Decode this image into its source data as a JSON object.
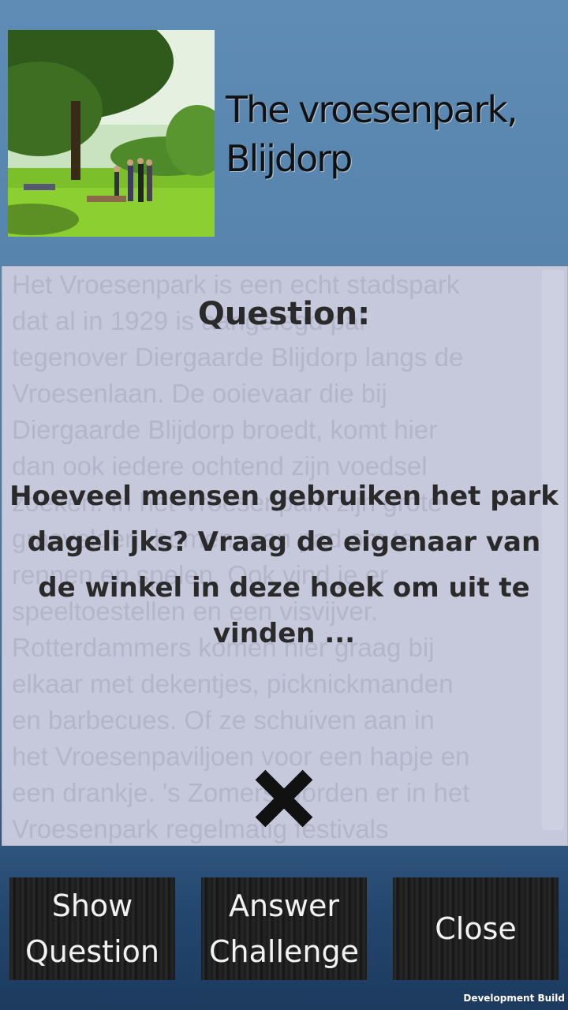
{
  "place": {
    "title": "The vroesenpark, Blijdorp",
    "image": "park-photo"
  },
  "description": "Het Vroesenpark is een echt stadspark\ndat al in 1929 is aangelegd pal\ntegenover Diergaarde Blijdorp langs de\nVroesenlaan. De ooievaar die bij\nDiergaarde Blijdorp broedt, komt hier\ndan ook iedere ochtend zijn voedsel\nzoeken. In het Vroesenpark zijn grote\ngrasvelden, bomen, een pad om te\nrennen en spelen. Ook vind je er\nspeeltoestellen en een visvijver.\nRotterdammers komen hier graag bij\nelkaar met dekentjes, picknickmanden\nen barbecues. Of ze schuiven aan in\nhet Vroesenpaviljoen voor een hapje en\neen drankje. 's Zomers worden er in het\nVroesenpark regelmatig festivals",
  "question": {
    "header": "Question:",
    "text": "Hoeveel mensen gebruiken het park dageli jks? Vraag de eigenaar van de winkel in deze hoek om uit te vinden ...",
    "close_icon": "close-icon"
  },
  "buttons": {
    "show_question": "Show\nQuestion",
    "answer_challenge": "Answer\nChallenge",
    "close": "Close"
  },
  "footer": {
    "dev_build": "Development Build"
  }
}
